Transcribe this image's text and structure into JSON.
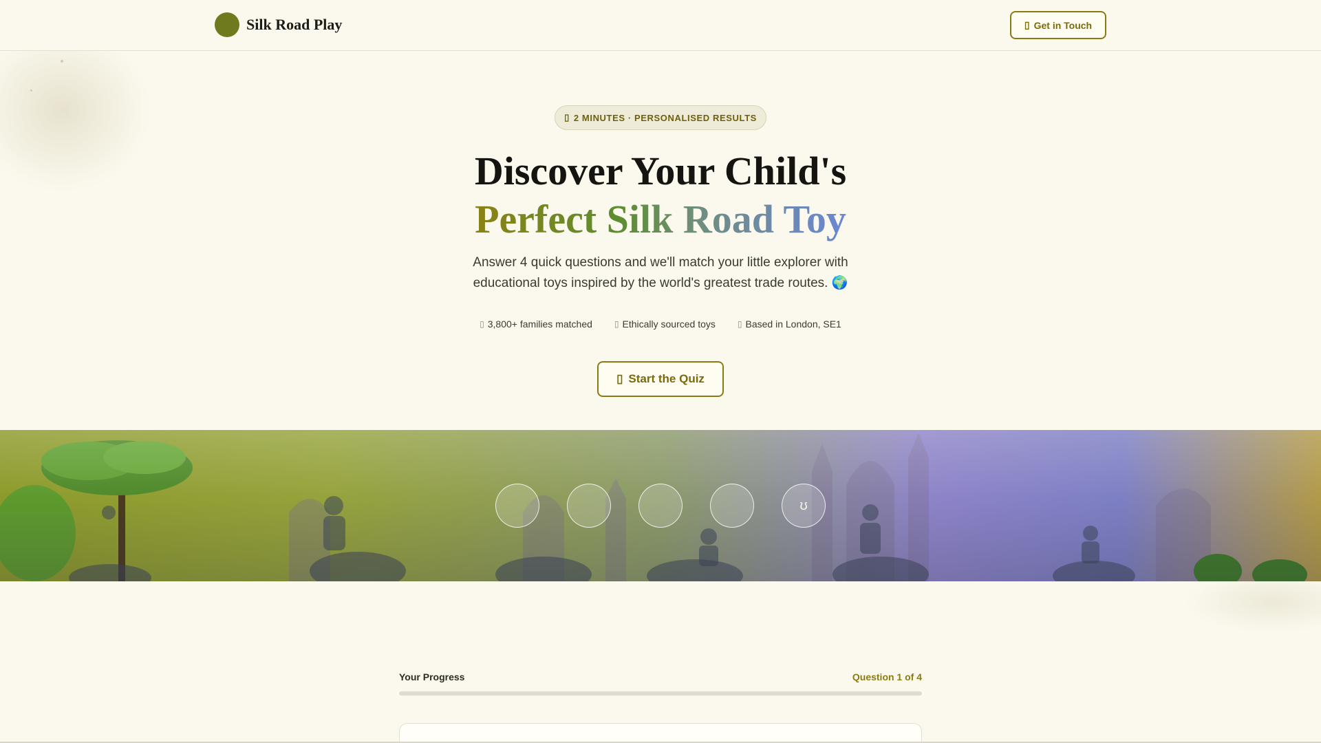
{
  "nav": {
    "brand_name": "Silk Road Play",
    "brand_icon": "camel-icon",
    "contact_label": "Get in Touch",
    "contact_icon": "envelope-icon"
  },
  "hero": {
    "pill_label": "2 MINUTES · PERSONALISED RESULTS",
    "pill_icon": "clock-icon",
    "headline_line1": "Discover Your Child's",
    "headline_line2": "Perfect Silk Road Toy",
    "subtitle": "Answer 4 quick questions and we'll match your little explorer with educational toys inspired by the world's greatest trade routes. 🌍",
    "stats": [
      {
        "icon": "users-icon",
        "label": "3,800+ families matched"
      },
      {
        "icon": "leaf-icon",
        "label": "Ethically sourced toys"
      },
      {
        "icon": "map-pin-icon",
        "label": "Based in London, SE1"
      }
    ],
    "cta_label": "Start the Quiz",
    "cta_icon": "play-icon"
  },
  "banner": {
    "circle_icons": [
      "camel-icon",
      "globe-icon",
      "puzzle-icon",
      "book-icon",
      "gift-icon"
    ],
    "circle_glyphs": [
      "",
      "",
      "",
      "",
      "ʊ"
    ]
  },
  "progress": {
    "label": "Your Progress",
    "count_text": "Question 1 of 4",
    "value": 0.0
  },
  "colors": {
    "accent": "#8a7a12",
    "brand": "#6f7a1e",
    "background": "#fbf9ee"
  }
}
